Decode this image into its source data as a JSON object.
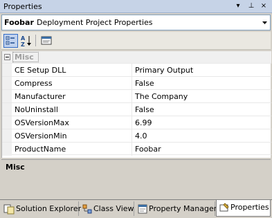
{
  "window": {
    "title": "Properties",
    "buttons": [
      "▾",
      "⊥",
      "×"
    ]
  },
  "object_selector": {
    "name": "Foobar",
    "type": "Deployment Project Properties"
  },
  "toolbar": {
    "buttons": [
      "categorized-icon",
      "alphabetical-icon",
      "property-pages-icon"
    ]
  },
  "grid": {
    "category": "Misc",
    "properties": [
      {
        "name": "CE Setup DLL",
        "value": "Primary Output"
      },
      {
        "name": "Compress",
        "value": "False"
      },
      {
        "name": "Manufacturer",
        "value": "The Company"
      },
      {
        "name": "NoUninstall",
        "value": "False"
      },
      {
        "name": "OSVersionMax",
        "value": "6.99"
      },
      {
        "name": "OSVersionMin",
        "value": "4.0"
      },
      {
        "name": "ProductName",
        "value": "Foobar"
      }
    ]
  },
  "description": {
    "title": "Misc"
  },
  "tabs": [
    {
      "label": "Solution Explorer"
    },
    {
      "label": "Class View"
    },
    {
      "label": "Property Manager"
    },
    {
      "label": "Properties"
    }
  ]
}
